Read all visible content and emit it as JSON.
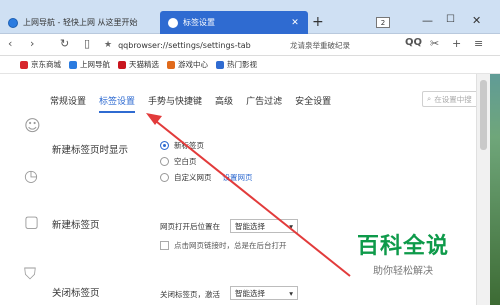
{
  "tabs": [
    {
      "title": "上网导航 - 轻快上网 从这里开始",
      "active": false
    },
    {
      "title": "标签设置",
      "active": true
    }
  ],
  "tab_counter": "2",
  "window_controls": {
    "minimize": "—",
    "maximize": "☐",
    "close": "✕"
  },
  "address": {
    "url": "qqbrowser://settings/settings-tab",
    "hint": "龙请泉举重破纪录"
  },
  "bookmarks": [
    {
      "label": "京东商城",
      "color": "#d7262c"
    },
    {
      "label": "上网导航",
      "color": "#2a7be0"
    },
    {
      "label": "天猫精选",
      "color": "#c9151e"
    },
    {
      "label": "游戏中心",
      "color": "#e06a1b"
    },
    {
      "label": "热门影视",
      "color": "#2f6bd1"
    }
  ],
  "settings_nav": [
    {
      "label": "常规设置",
      "active": false
    },
    {
      "label": "标签设置",
      "active": true
    },
    {
      "label": "手势与快捷键",
      "active": false
    },
    {
      "label": "高级",
      "active": false
    },
    {
      "label": "广告过滤",
      "active": false
    },
    {
      "label": "安全设置",
      "active": false
    }
  ],
  "search": {
    "placeholder": "在设置中搜"
  },
  "sections": {
    "newtab_show": {
      "label": "新建标签页时显示",
      "options": [
        "新标签页",
        "空白页",
        "自定义网页"
      ],
      "selected": 0,
      "set_link": "设置网页"
    },
    "newtab": {
      "label": "新建标签页",
      "open_position_label": "网页打开后位置在",
      "open_position_value": "智能选择",
      "checkbox_label": "点击网页链接时，总是在后台打开"
    },
    "closetab": {
      "label": "关闭标签页",
      "field_label": "关闭标签页，激活",
      "value": "智能选择"
    }
  },
  "watermark": {
    "title": "百科全说",
    "subtitle": "助你轻松解决"
  },
  "colors": {
    "accent": "#2f6bd1",
    "arrow": "#e23b3b",
    "watermark": "#0e9a4a"
  }
}
